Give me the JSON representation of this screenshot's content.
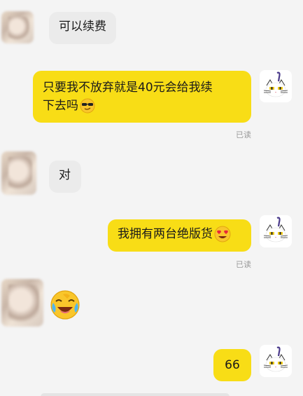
{
  "messages": [
    {
      "side": "left",
      "text": "可以续费"
    },
    {
      "side": "right",
      "text_line1": "只要我不放弃就是40元会给我续",
      "text_line2": "下去吗",
      "emoji": "cool-sunglasses-emoji",
      "status": "已读"
    },
    {
      "side": "left",
      "text": "对"
    },
    {
      "side": "right",
      "text": "我拥有两台绝版货",
      "emoji": "heart-eyes-emoji",
      "status": "已读"
    },
    {
      "side": "left",
      "emoji": "laughing-crying-emoji"
    },
    {
      "side": "right",
      "text": "66"
    }
  ],
  "colors": {
    "background": "#f4f4f4",
    "left_bubble": "#ebebeb",
    "right_bubble": "#f8dd16",
    "read_status": "#9a9a9a"
  }
}
